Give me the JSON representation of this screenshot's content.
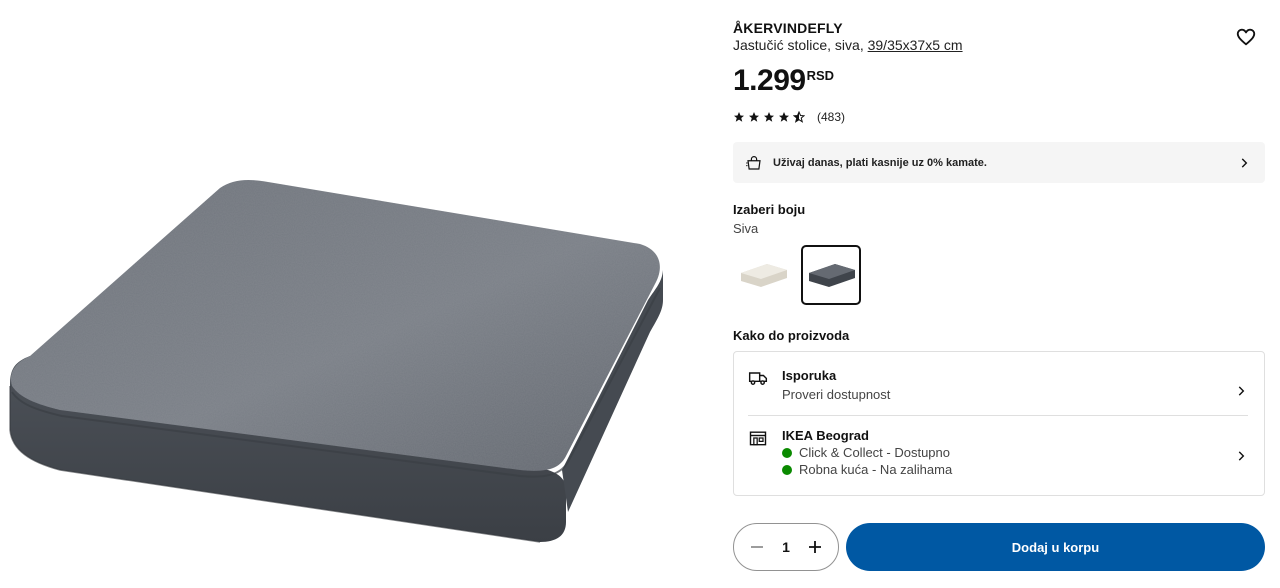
{
  "product": {
    "name": "ÅKERVINDEFLY",
    "description": "Jastučić stolice, siva, ",
    "dimensions": "39/35x37x5 cm",
    "price_amount": "1.299",
    "price_currency": "RSD",
    "rating": 4.5,
    "review_count": "(483)",
    "image_icon": "gray-seat-cushion-photo"
  },
  "promo": {
    "text": "Uživaj danas, plati kasnije uz 0% kamate.",
    "icon": "shopping-bag-icon"
  },
  "color": {
    "heading": "Izaberi boju",
    "selected": "Siva",
    "options": [
      {
        "id": "beige",
        "swatch": "#e6e1d6",
        "selected": false
      },
      {
        "id": "gray",
        "swatch": "#5b6068",
        "selected": true
      }
    ]
  },
  "availability": {
    "heading": "Kako do proizvoda",
    "delivery": {
      "title": "Isporuka",
      "subtitle": "Proveri dostupnost",
      "icon": "truck-icon"
    },
    "store": {
      "title": "IKEA Beograd",
      "icon": "store-icon",
      "lines": [
        "Click & Collect - Dostupno",
        "Robna kuća - Na zalihama"
      ],
      "status_color": "#0a8a00"
    }
  },
  "cart": {
    "quantity": "1",
    "add_label": "Dodaj u korpu",
    "accent": "#0058a3"
  }
}
